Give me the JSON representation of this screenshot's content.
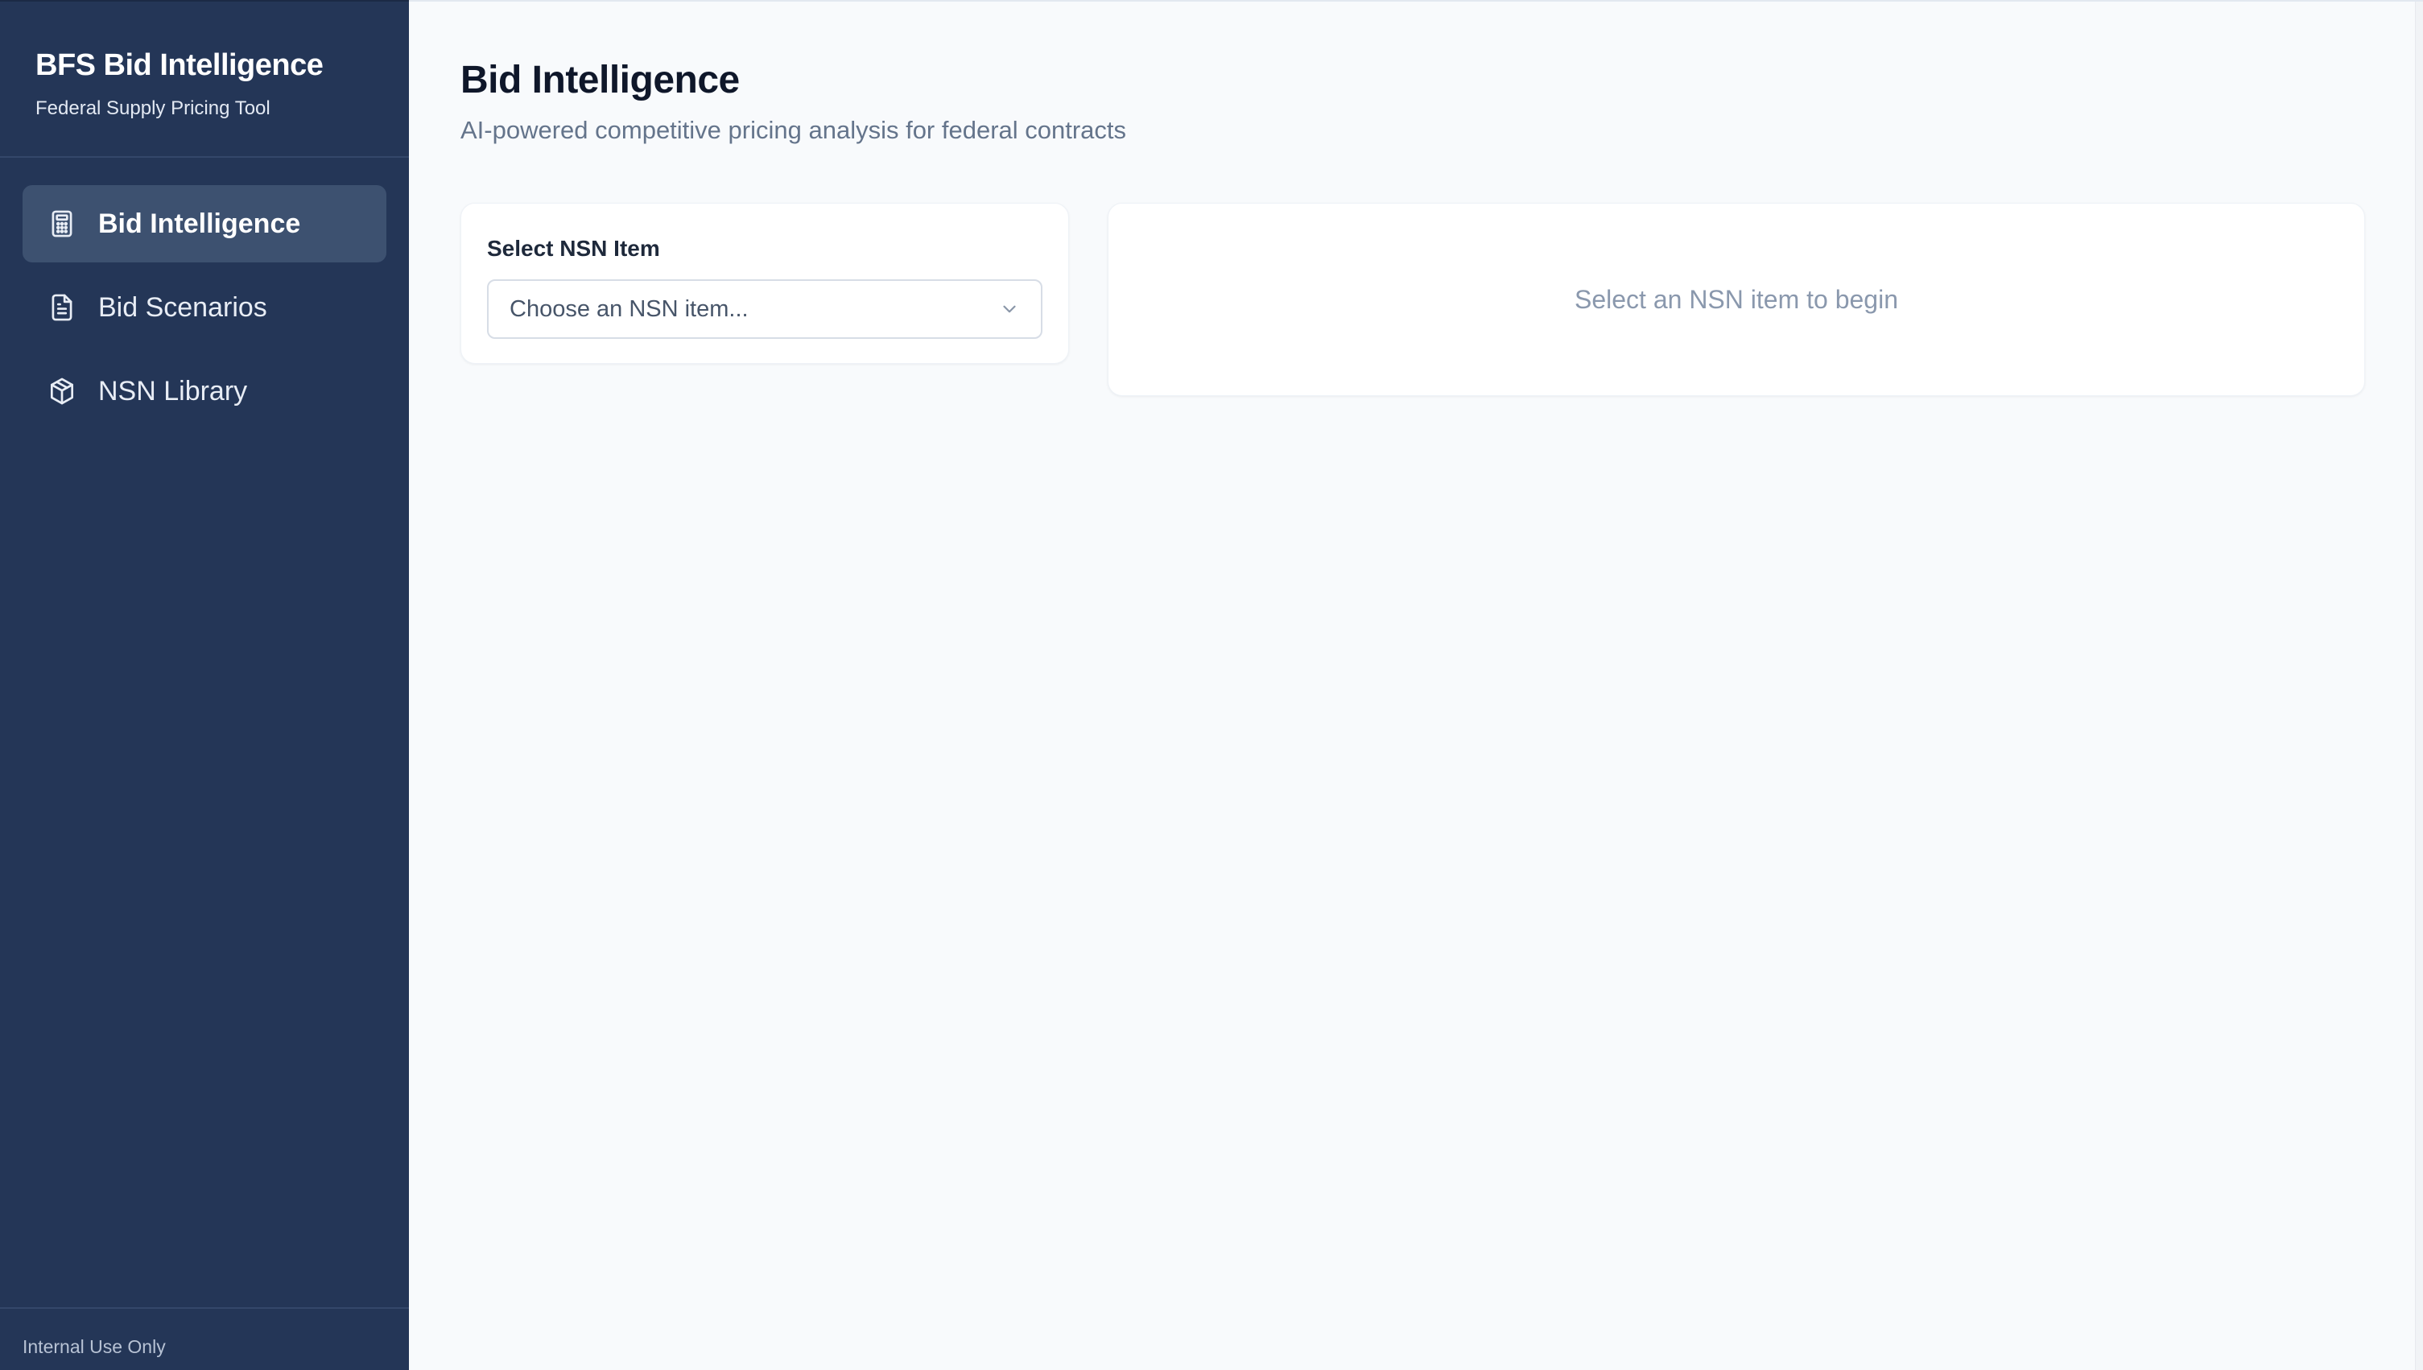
{
  "sidebar": {
    "brand_title": "BFS Bid Intelligence",
    "brand_subtitle": "Federal Supply Pricing Tool",
    "items": [
      {
        "label": "Bid Intelligence",
        "icon": "calculator-icon",
        "active": true
      },
      {
        "label": "Bid Scenarios",
        "icon": "document-icon",
        "active": false
      },
      {
        "label": "NSN Library",
        "icon": "package-icon",
        "active": false
      }
    ],
    "footer": "Internal Use Only"
  },
  "main": {
    "title": "Bid Intelligence",
    "subtitle": "AI-powered competitive pricing analysis for federal contracts",
    "select": {
      "label": "Select NSN Item",
      "placeholder": "Choose an NSN item..."
    },
    "empty_state": "Select an NSN item to begin"
  },
  "colors": {
    "sidebar_bg": "#243657",
    "active_item_bg": "#3d5170",
    "page_bg": "#f8fafc",
    "title_text": "#0f172a",
    "muted_text": "#64748b"
  }
}
